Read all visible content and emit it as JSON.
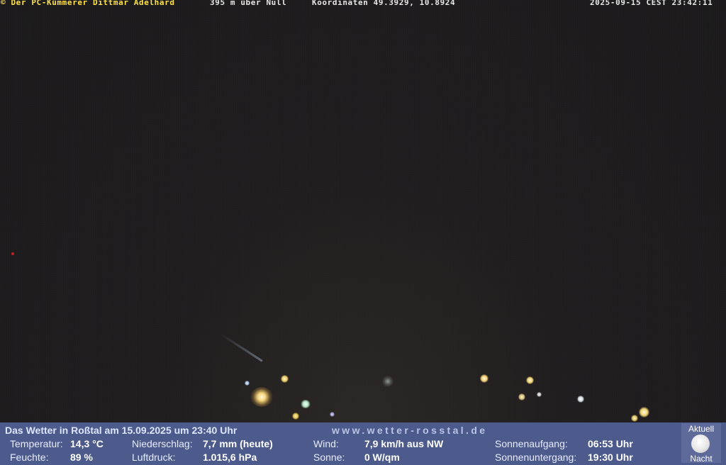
{
  "header": {
    "copyright": "© Der PC-Kümmerer Dittmar Adelhard",
    "altitude": "395 m über Null",
    "coordinates": "Koordinaten 49.3929, 10.8924",
    "timestamp": "2025-09-15 CEST 23:42:11"
  },
  "panel": {
    "title": "Das Wetter in Roßtal am 15.09.2025 um 23:40 Uhr",
    "url": "www.wetter-rosstal.de",
    "temperature": {
      "label": "Temperatur:",
      "value": "14,3 °C"
    },
    "humidity": {
      "label": "Feuchte:",
      "value": "89 %"
    },
    "precipitation": {
      "label": "Niederschlag:",
      "value": "7,7 mm (heute)"
    },
    "pressure": {
      "label": "Luftdruck:",
      "value": "1.015,6 hPa"
    },
    "wind": {
      "label": "Wind:",
      "value": "7,9 km/h aus NW"
    },
    "sun": {
      "label": "Sonne:",
      "value": "0 W/qm"
    },
    "sunrise": {
      "label": "Sonnenaufgang:",
      "value": "06:53 Uhr"
    },
    "sunset": {
      "label": "Sonnenuntergang:",
      "value": "19:30 Uhr"
    },
    "moon": {
      "top": "Aktuell",
      "bottom": "Nacht",
      "icon": "moon-icon"
    }
  }
}
